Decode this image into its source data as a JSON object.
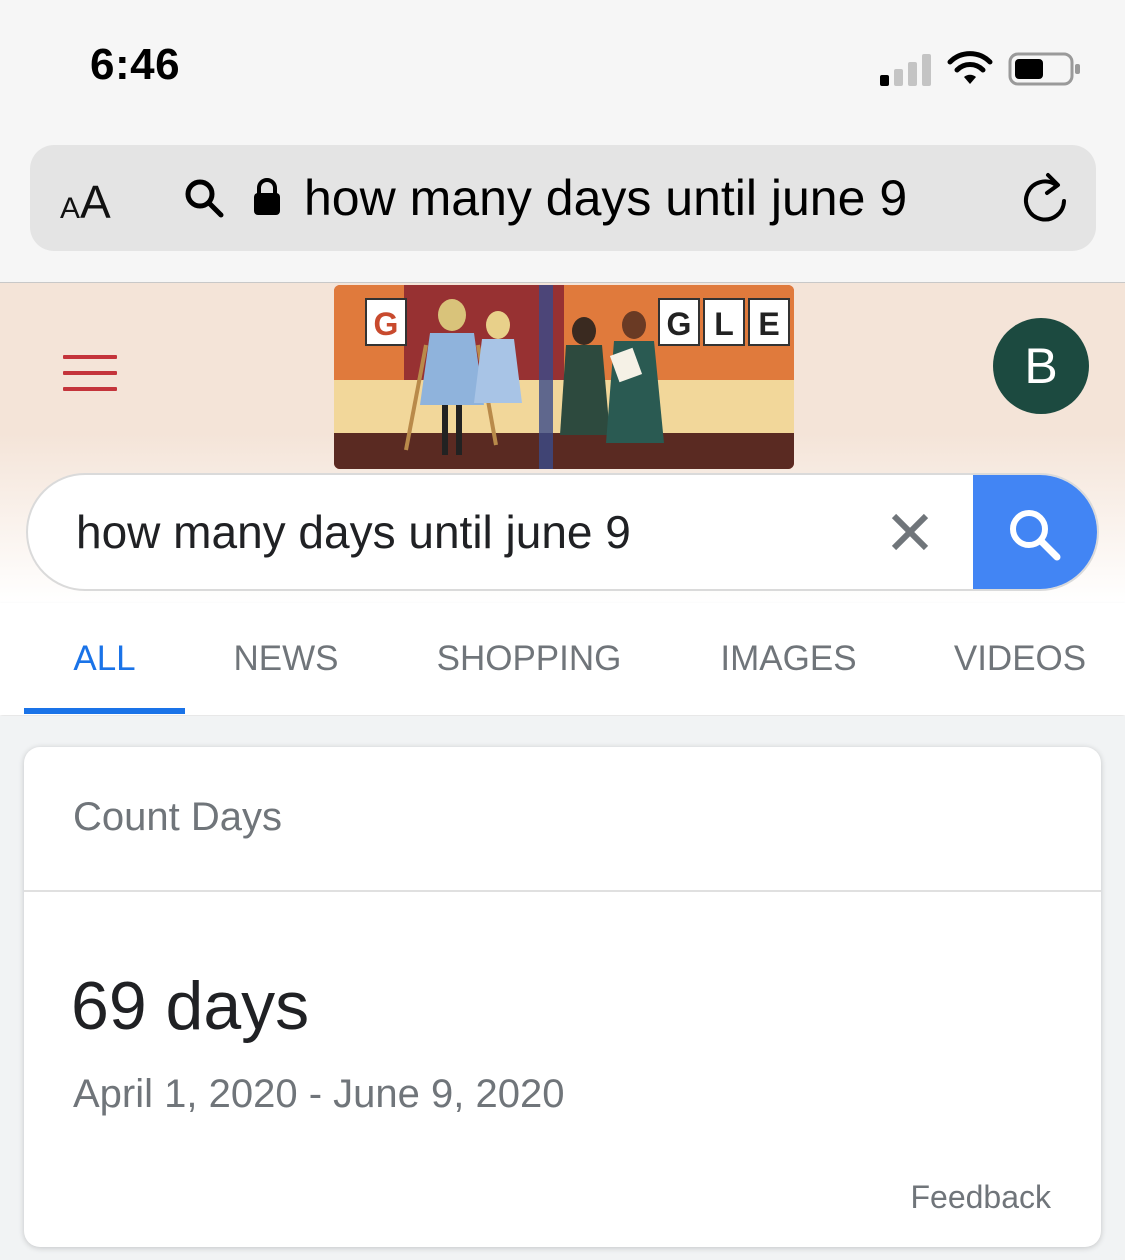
{
  "status_bar": {
    "time": "6:46"
  },
  "browser": {
    "aa_small": "A",
    "aa_large": "A",
    "url_text": "how many days until june 9"
  },
  "google": {
    "doodle_letters": [
      "G",
      "G",
      "L",
      "E"
    ],
    "avatar_letter": "B",
    "search_query": "how many days until june 9",
    "colors": {
      "accent": "#1a73e8",
      "search_button": "#4285f4",
      "hamburger": "#c4343b",
      "avatar_bg": "#1c4a40"
    }
  },
  "tabs": [
    {
      "label": "ALL",
      "active": true
    },
    {
      "label": "NEWS",
      "active": false
    },
    {
      "label": "SHOPPING",
      "active": false
    },
    {
      "label": "IMAGES",
      "active": false
    },
    {
      "label": "VIDEOS",
      "active": false
    }
  ],
  "result_card": {
    "title": "Count Days",
    "value": "69 days",
    "range": "April 1, 2020 - June 9, 2020",
    "feedback": "Feedback"
  }
}
